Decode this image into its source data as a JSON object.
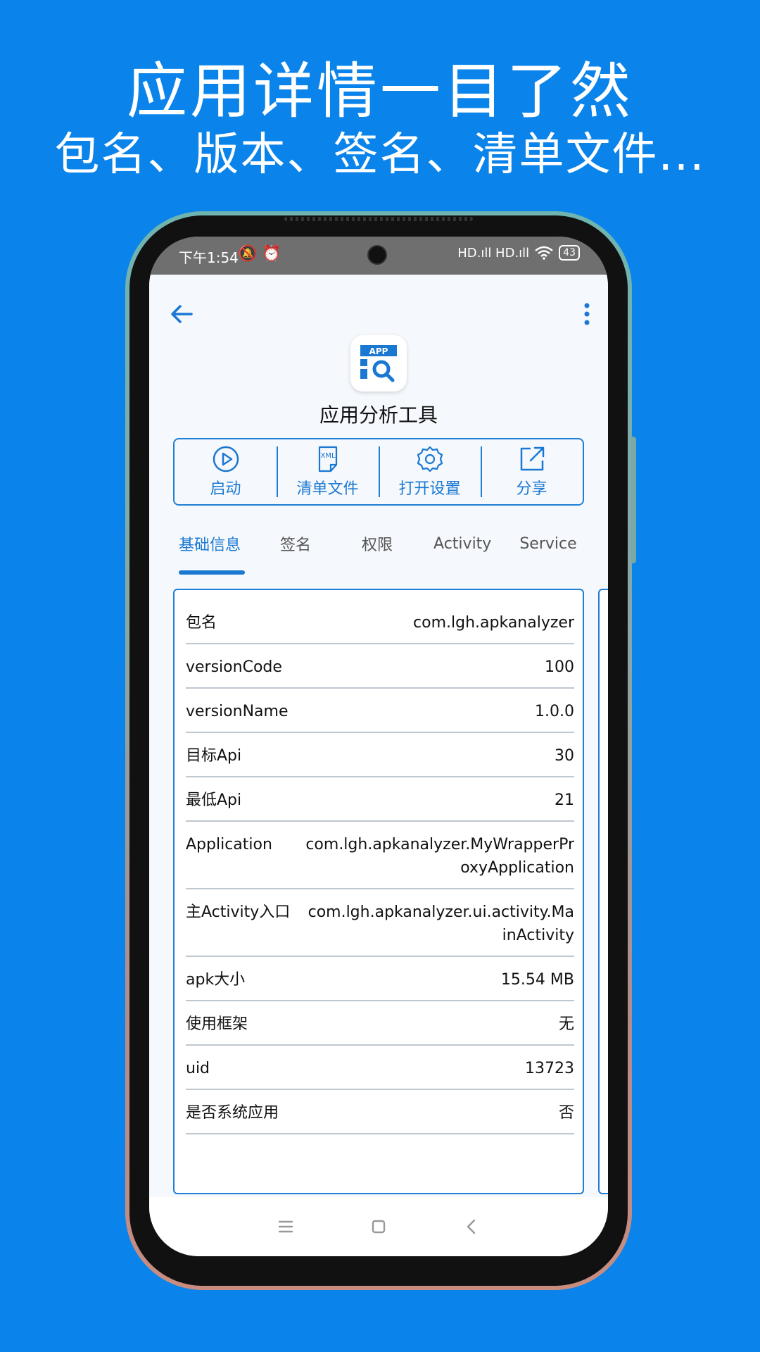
{
  "promo": {
    "headline": "应用详情一目了然",
    "subheadline": "包名、版本、签名、清单文件..."
  },
  "status": {
    "time": "下午1:54",
    "left_icons": "🔕 ⏰",
    "signal": "HD.ıll HD.ıll",
    "wifi_icon": "wifi-icon",
    "battery": "43"
  },
  "toolbar": {
    "back_icon": "arrow-left-icon",
    "more_icon": "more-vertical-icon"
  },
  "app": {
    "icon_text": "APP",
    "name": "应用分析工具"
  },
  "actions": [
    {
      "label": "启动",
      "icon": "play-icon"
    },
    {
      "label": "清单文件",
      "icon": "xml-file-icon",
      "icon_text": "XML"
    },
    {
      "label": "打开设置",
      "icon": "gear-icon"
    },
    {
      "label": "分享",
      "icon": "share-icon"
    }
  ],
  "tabs": [
    "基础信息",
    "签名",
    "权限",
    "Activity",
    "Service"
  ],
  "info_rows": [
    {
      "label": "包名",
      "value": "com.lgh.apkanalyzer"
    },
    {
      "label": "versionCode",
      "value": "100"
    },
    {
      "label": "versionName",
      "value": "1.0.0"
    },
    {
      "label": "目标Api",
      "value": "30"
    },
    {
      "label": "最低Api",
      "value": "21"
    },
    {
      "label": "Application",
      "value": "com.lgh.apkanalyzer.MyWrapperProxyApplication"
    },
    {
      "label": "主Activity入口",
      "value": "com.lgh.apkanalyzer.ui.activity.MainActivity"
    },
    {
      "label": "apk大小",
      "value": "15.54 MB"
    },
    {
      "label": "使用框架",
      "value": "无"
    },
    {
      "label": "uid",
      "value": "13723"
    },
    {
      "label": "是否系统应用",
      "value": "否"
    }
  ],
  "nav": {
    "menu_icon": "menu-icon",
    "home_icon": "home-square-icon",
    "back_icon": "back-chevron-icon"
  },
  "colors": {
    "background": "#0a84ea",
    "accent": "#1a78d2"
  }
}
